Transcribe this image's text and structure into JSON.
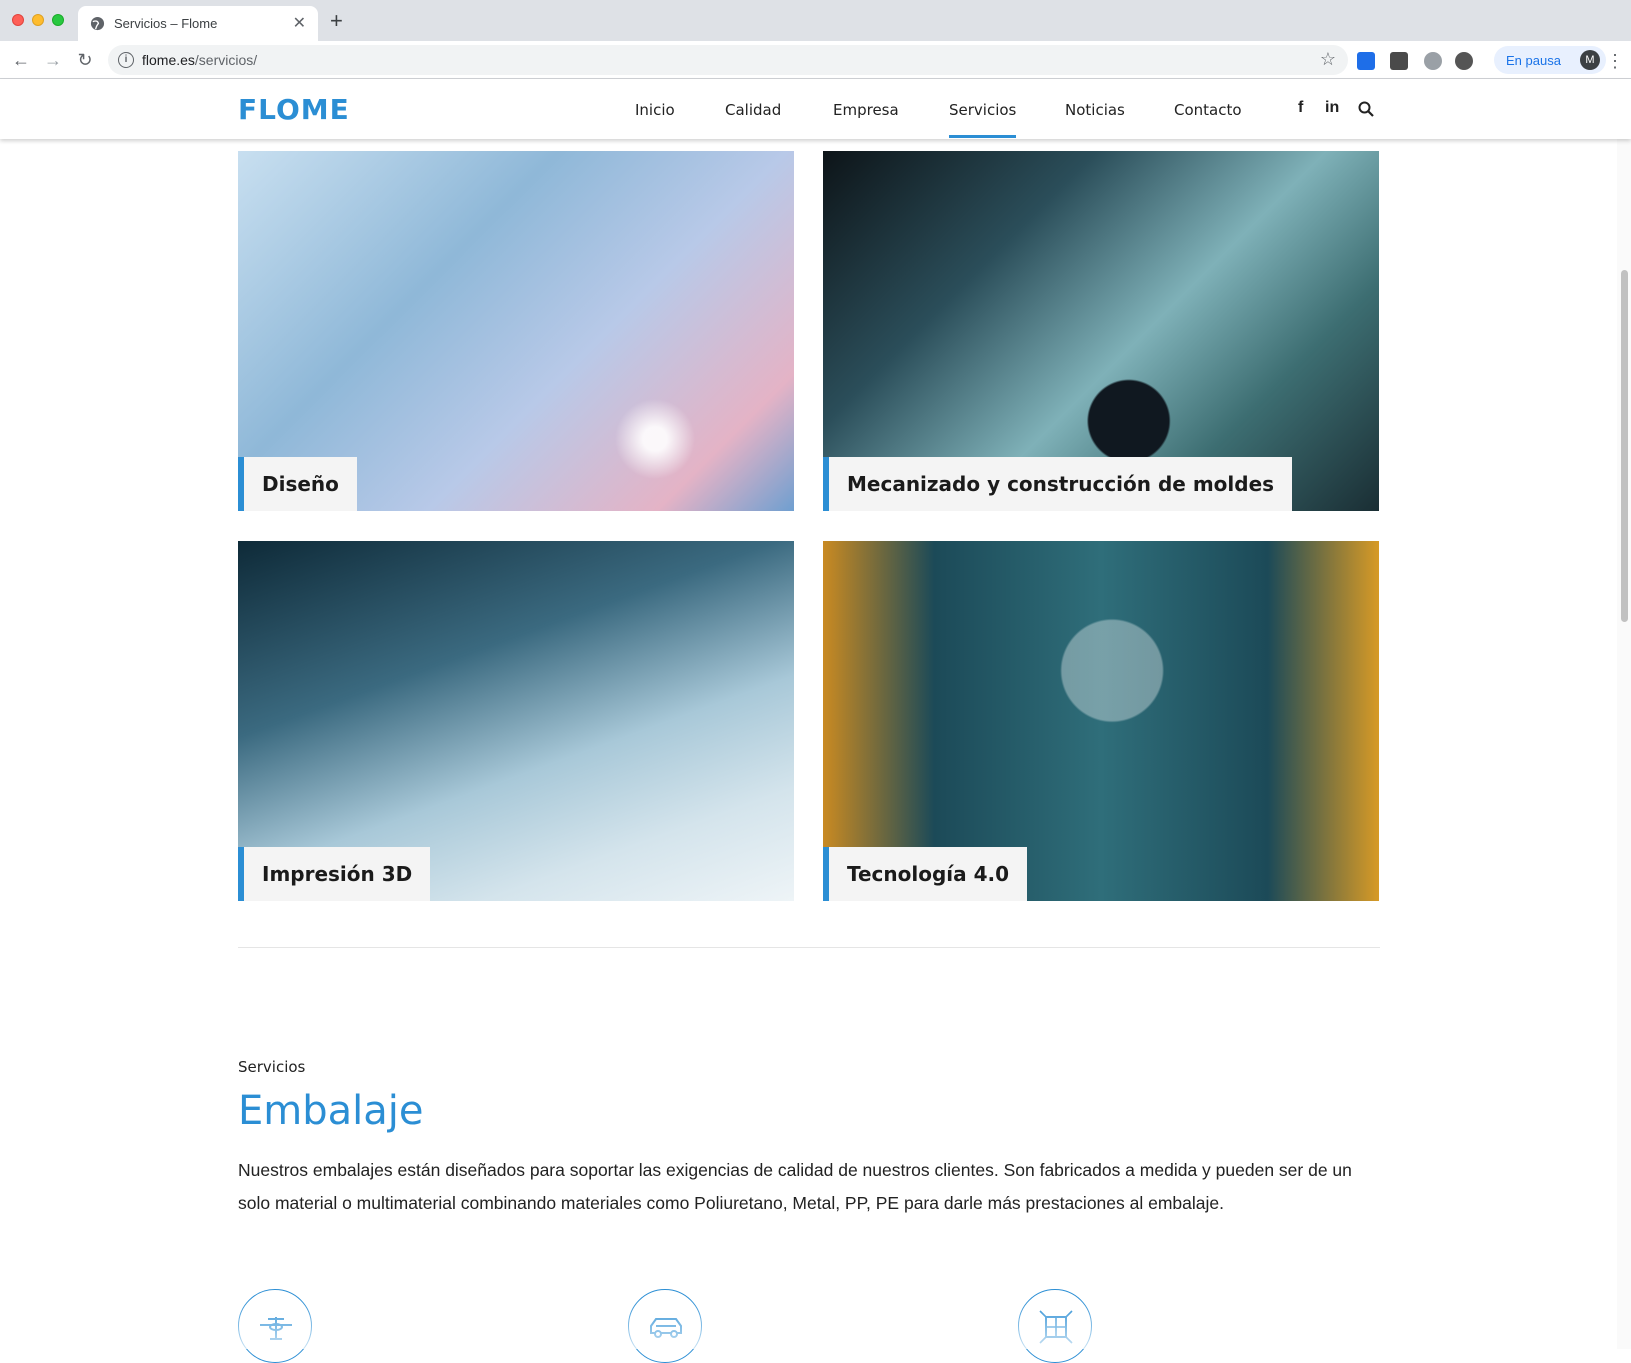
{
  "browser": {
    "tab_title": "Servicios – Flome",
    "url_host": "flome.es",
    "url_path": "/servicios/",
    "profile_status": "En pausa",
    "profile_initial": "M"
  },
  "site": {
    "logo": "FLOME",
    "nav": [
      {
        "label": "Inicio"
      },
      {
        "label": "Calidad"
      },
      {
        "label": "Empresa"
      },
      {
        "label": "Servicios",
        "active": true
      },
      {
        "label": "Noticias"
      },
      {
        "label": "Contacto"
      }
    ],
    "social": {
      "facebook": "f",
      "linkedin": "in"
    }
  },
  "cards": [
    {
      "caption": "Diseño"
    },
    {
      "caption": "Mecanizado y construcción de moldes"
    },
    {
      "caption": "Impresión 3D"
    },
    {
      "caption": "Tecnología 4.0"
    }
  ],
  "section": {
    "kicker": "Servicios",
    "title": "Embalaje",
    "body": "Nuestros embalajes están diseñados para soportar las exigencias de calidad de nuestros clientes. Son fabricados a medida y pueden ser de un solo material o multimaterial combinando materiales como Poliuretano, Metal, PP, PE para darle más prestaciones al embalaje."
  },
  "features": [
    {
      "icon": "airplane-icon"
    },
    {
      "icon": "car-icon"
    },
    {
      "icon": "network-cube-icon"
    }
  ],
  "colors": {
    "accent": "#2b8ed4"
  }
}
